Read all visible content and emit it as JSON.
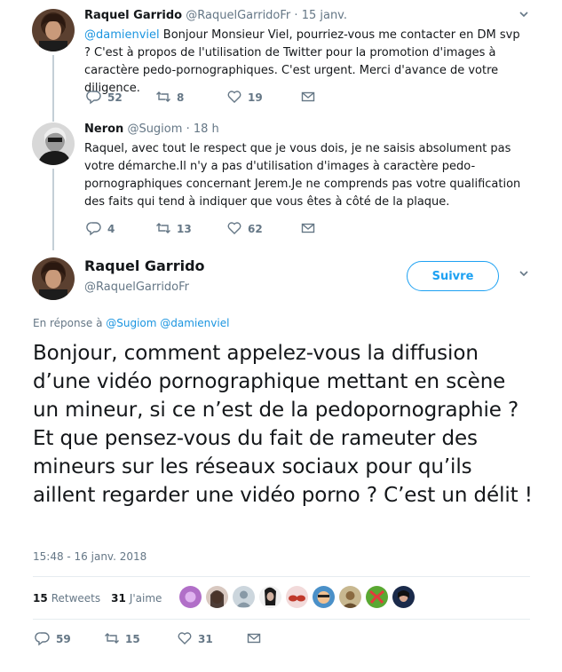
{
  "reply1": {
    "display_name": "Raquel Garrido",
    "handle": "@RaquelGarridoFr",
    "time": "15 janv.",
    "mention": "@damienviel",
    "text_after_mention": " Bonjour Monsieur Viel, pourriez-vous me contacter en DM svp ? C'est à propos de l'utilisation de Twitter pour la promotion d'images à caractère pedo-pornographiques. C'est urgent. Merci d'avance de votre diligence.",
    "replies": "52",
    "retweets": "8",
    "likes": "19"
  },
  "reply2": {
    "display_name": "Neron",
    "handle": "@Sugiom",
    "time": "18 h",
    "text": "Raquel, avec tout le respect que je vous dois, je ne saisis absolument pas votre démarche.Il n'y a pas d'utilisation d'images à caractère pedo-pornographiques concernant Jerem.Je ne comprends pas votre qualification des faits qui tend à indiquer que vous êtes à côté de la plaque.",
    "replies": "4",
    "retweets": "13",
    "likes": "62"
  },
  "main_tweet": {
    "display_name": "Raquel Garrido",
    "handle": "@RaquelGarridoFr",
    "follow_label": "Suivre",
    "reply_prefix": "En réponse à",
    "reply_to_1": "@Sugiom",
    "reply_to_2": "@damienviel",
    "text": "Bonjour, comment appelez-vous la diffusion d’une vidéo pornographique mettant en scène un mineur, si ce n’est de la pedopornographie ? Et que pensez-vous du fait de rameuter des mineurs sur les réseaux sociaux pour qu’ils aillent regarder une vidéo porno ? C’est un délit !",
    "timestamp": "15:48 - 16 janv. 2018",
    "retweet_count": "15",
    "retweet_label": "Retweets",
    "like_count": "31",
    "like_label": "J'aime",
    "replies": "59",
    "retweets": "15",
    "likes": "31"
  },
  "colors": {
    "accent": "#1da1f2",
    "mention": "#1b95e0",
    "muted": "#657786",
    "thread_line": "#c4cfd6"
  },
  "icons": {
    "reply": "reply-icon",
    "retweet": "retweet-icon",
    "like": "heart-icon",
    "dm": "envelope-icon",
    "more": "chevron-down-icon"
  }
}
